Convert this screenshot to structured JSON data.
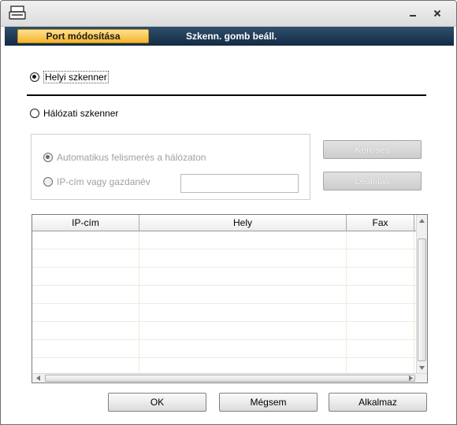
{
  "tabs": {
    "active_label": "Port módosítása",
    "inactive_label": "Szkenn. gomb beáll."
  },
  "options": {
    "local_scanner": "Helyi szkenner",
    "network_scanner": "Hálózati szkenner",
    "auto_detect": "Automatikus felismerés a hálózaton",
    "ip_or_host": "IP-cím vagy gazdanév",
    "ip_value": ""
  },
  "buttons": {
    "search": "Keresés",
    "stop": "Leállítás",
    "ok": "OK",
    "cancel": "Mégsem",
    "apply": "Alkalmaz"
  },
  "table": {
    "columns": [
      "IP-cím",
      "Hely",
      "Fax"
    ]
  },
  "icons": {
    "app": "scanner-icon",
    "minimize": "minimize-icon",
    "close": "close-icon"
  }
}
